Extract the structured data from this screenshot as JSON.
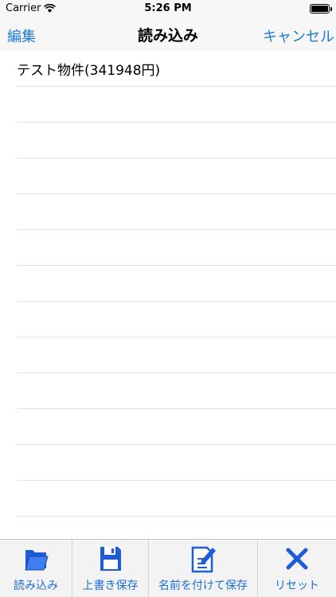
{
  "status_bar": {
    "carrier": "Carrier",
    "time": "5:26 PM"
  },
  "nav": {
    "left": "編集",
    "title": "読み込み",
    "right": "キャンセル"
  },
  "list": {
    "items": [
      "テスト物件(341948円)",
      "",
      "",
      "",
      "",
      "",
      "",
      "",
      "",
      "",
      "",
      "",
      "",
      ""
    ]
  },
  "tabs": [
    {
      "label": "読み込み",
      "icon": "folder-icon"
    },
    {
      "label": "上書き保存",
      "icon": "floppy-disk-icon"
    },
    {
      "label": "名前を付けて保存",
      "icon": "edit-document-icon"
    },
    {
      "label": "リセット",
      "icon": "close-x-icon"
    }
  ],
  "colors": {
    "accent": "#1a7ad8",
    "tab_icon": "#1e5bd8",
    "separator": "#e3e3e3"
  }
}
